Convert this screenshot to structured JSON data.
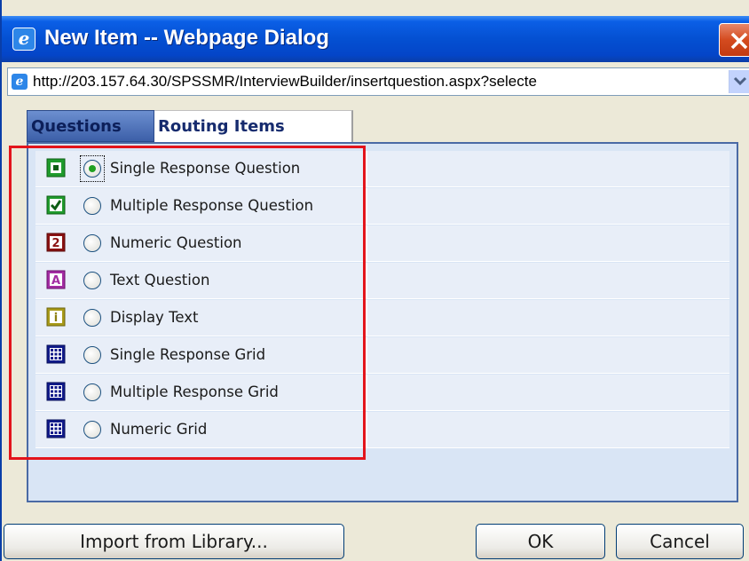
{
  "window": {
    "title": "New Item -- Webpage Dialog",
    "address": "http://203.157.64.30/SPSSMR/InterviewBuilder/insertquestion.aspx?selecte"
  },
  "tabs": [
    {
      "label": "Questions",
      "selected": true
    },
    {
      "label": "Routing Items",
      "selected": false
    }
  ],
  "items": [
    {
      "label": "Single Response Question",
      "icon": "single-response-icon",
      "selected": true
    },
    {
      "label": "Multiple Response Question",
      "icon": "multiple-response-icon",
      "selected": false
    },
    {
      "label": "Numeric Question",
      "icon": "numeric-question-icon",
      "selected": false
    },
    {
      "label": "Text Question",
      "icon": "text-question-icon",
      "selected": false
    },
    {
      "label": "Display Text",
      "icon": "display-text-icon",
      "selected": false
    },
    {
      "label": "Single Response Grid",
      "icon": "grid-icon",
      "selected": false
    },
    {
      "label": "Multiple Response Grid",
      "icon": "grid-icon",
      "selected": false
    },
    {
      "label": "Numeric Grid",
      "icon": "grid-icon",
      "selected": false
    }
  ],
  "icon_glyphs": {
    "numeric": "2",
    "text": "A",
    "display": "i"
  },
  "buttons": {
    "import_label": "Import from Library...",
    "ok_label": "OK",
    "cancel_label": "Cancel"
  },
  "colors": {
    "title_bar": "#0450d2",
    "highlight_box": "#e3141b",
    "selected_tab": "#3c5fa8"
  }
}
